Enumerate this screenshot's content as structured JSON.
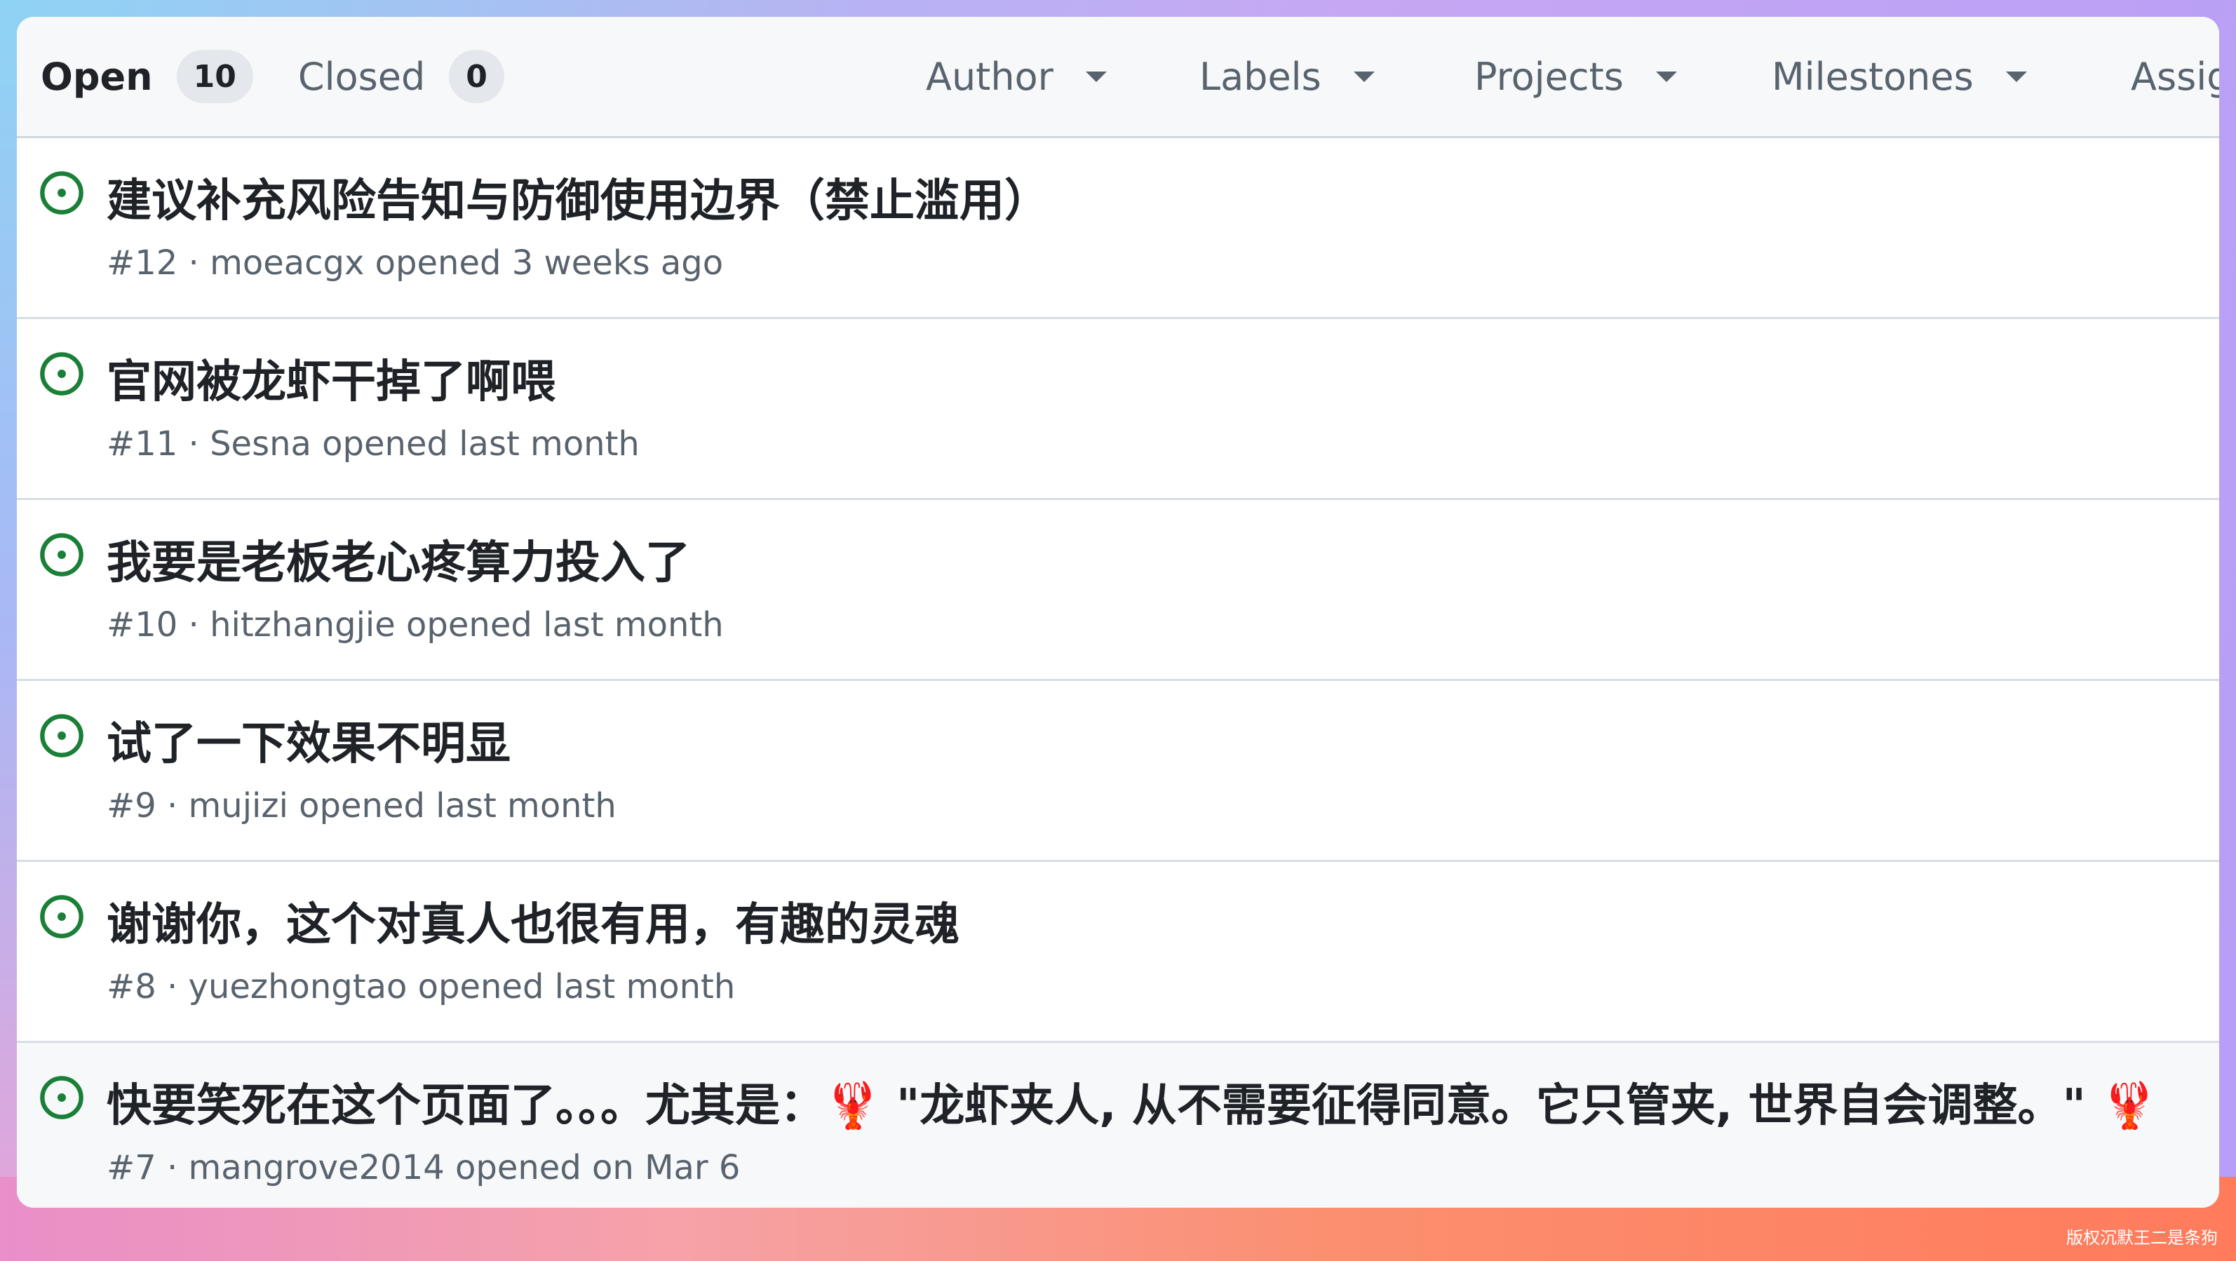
{
  "tabs": {
    "open_label": "Open",
    "open_count": "10",
    "closed_label": "Closed",
    "closed_count": "0"
  },
  "filters": {
    "author": "Author",
    "labels": "Labels",
    "projects": "Projects",
    "milestones": "Milestones",
    "assignee": "Assig"
  },
  "issues": [
    {
      "title": "建议补充风险告知与防御使用边界（禁止滥用）",
      "meta": "#12 · moeacgx opened 3 weeks ago"
    },
    {
      "title": "官网被龙虾干掉了啊喂",
      "meta": "#11 · Sesna opened last month"
    },
    {
      "title": "我要是老板老心疼算力投入了",
      "meta": "#10 · hitzhangjie opened last month"
    },
    {
      "title": "试了一下效果不明显",
      "meta": "#9 · mujizi opened last month"
    },
    {
      "title": "谢谢你，这个对真人也很有用，有趣的灵魂",
      "meta": "#8 · yuezhongtao opened last month"
    },
    {
      "title": "快要笑死在这个页面了。。。尤其是：🦞 \"龙虾夹人, 从不需要征得同意。它只管夹, 世界自会调整。\" 🦞",
      "meta": "#7 · mangrove2014 opened on Mar 6"
    }
  ],
  "icons": {
    "issue": "issue-opened-icon",
    "caret": "triangle-down-icon"
  },
  "colors": {
    "open_green": "#1a7f37",
    "muted_text": "#59636e",
    "title_text": "#1f2328"
  },
  "watermark": "版权沉默王二是条狗"
}
